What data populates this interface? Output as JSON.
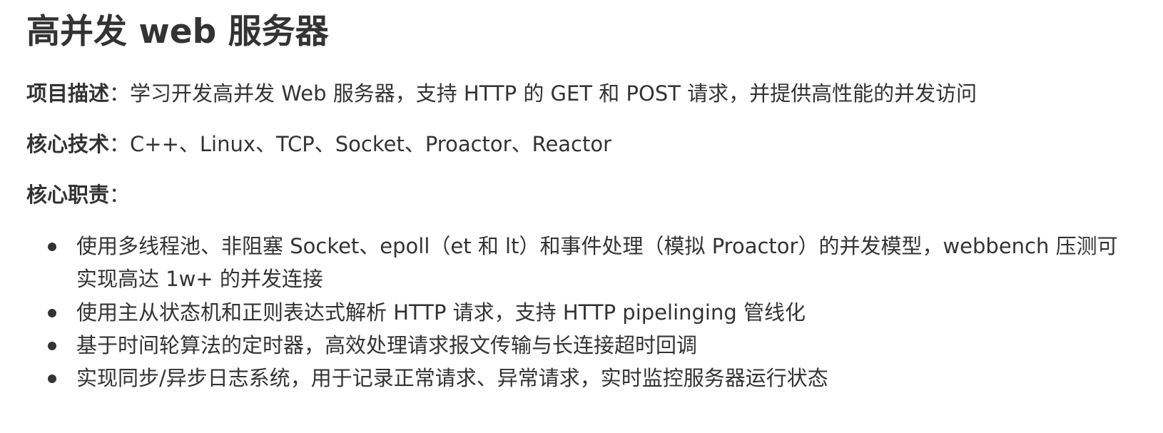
{
  "title": "高并发 web 服务器",
  "fields": {
    "description": {
      "label": "项目描述",
      "colon": "：",
      "value": "学习开发高并发 Web 服务器，支持 HTTP 的 GET 和 POST 请求，并提供高性能的并发访问"
    },
    "tech": {
      "label": "核心技术",
      "colon": "：",
      "value": "C++、Linux、TCP、Socket、Proactor、Reactor"
    },
    "duties": {
      "label": "核心职责",
      "colon": "："
    }
  },
  "bullets": [
    "使用多线程池、非阻塞 Socket、epoll（et 和 lt）和事件处理（模拟 Proactor）的并发模型，webbench 压测可实现高达 1w+ 的并发连接",
    "使用主从状态机和正则表达式解析 HTTP 请求，支持 HTTP pipelinging 管线化",
    "基于时间轮算法的定时器，高效处理请求报文传输与长连接超时回调",
    "实现同步/异步日志系统，用于记录正常请求、异常请求，实时监控服务器运行状态"
  ]
}
